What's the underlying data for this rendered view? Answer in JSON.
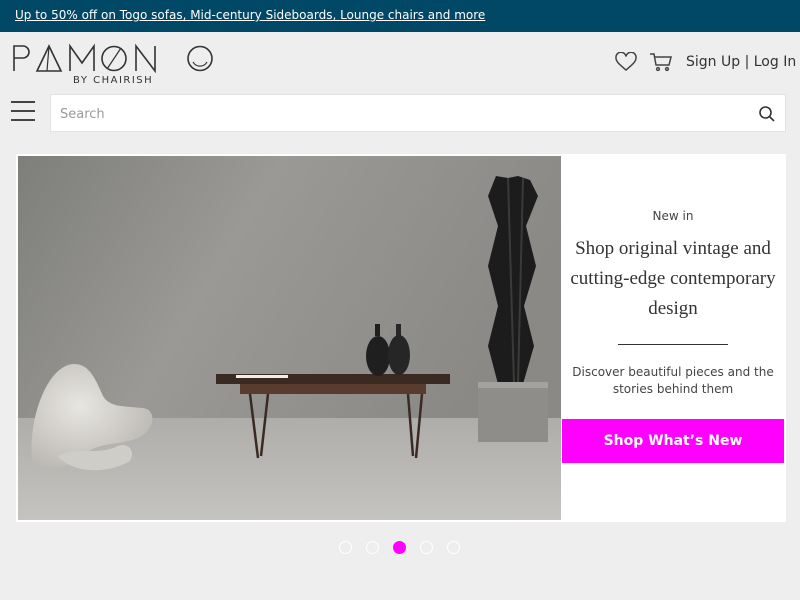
{
  "promo": {
    "text": "Up to 50% off on Togo sofas, Mid-century Sideboards, Lounge chairs and more"
  },
  "header": {
    "logo_text": "PAMONO",
    "logo_subtitle": "BY CHAIRISH",
    "favorites_icon": "heart-icon",
    "cart_icon": "shopping-cart-icon",
    "sign_up": "Sign Up",
    "separator": "|",
    "log_in": "Log In",
    "menu_icon": "hamburger-menu-icon"
  },
  "search": {
    "placeholder": "Search",
    "value": "",
    "icon": "search-icon"
  },
  "hero": {
    "eyebrow": "New in",
    "headline": "Shop original vintage and cutting-edge contemporary design",
    "description": "Discover beautiful pieces and the stories behind them",
    "cta_label": "Shop What’s New"
  },
  "carousel": {
    "slides": 5,
    "active_index": 3
  },
  "colors": {
    "promo_bg": "#004866",
    "accent": "#ff00ff",
    "page_bg": "#eeeeee"
  }
}
